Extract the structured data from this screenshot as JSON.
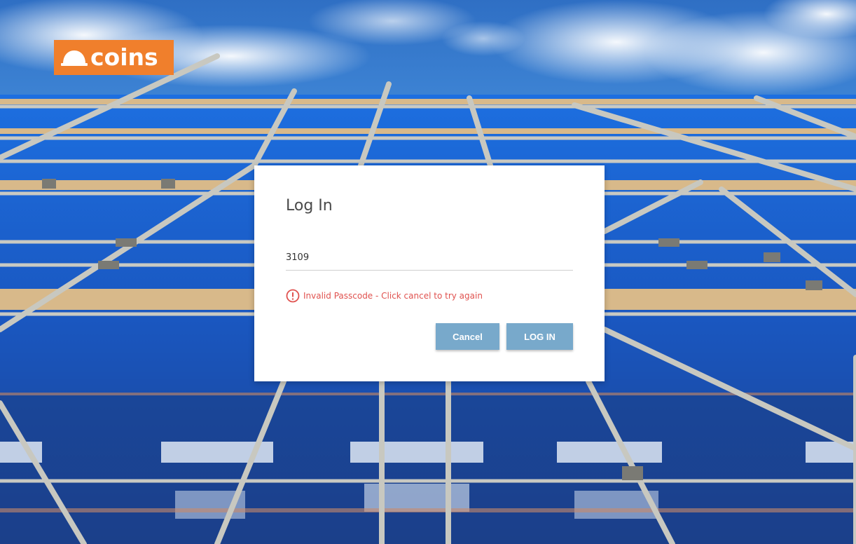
{
  "brand": {
    "logo_text": "coins",
    "logo_color": "#f07f2c"
  },
  "dialog": {
    "title": "Log In",
    "passcode_value": "3109",
    "error_message": "Invalid Passcode - Click cancel to try again",
    "error_color": "#e0524f",
    "cancel_label": "Cancel",
    "login_label": "LOG IN",
    "button_color": "#78a9cb"
  },
  "icons": {
    "logo_icon": "hard-hat-icon",
    "error_icon": "exclamation-circle-icon"
  }
}
